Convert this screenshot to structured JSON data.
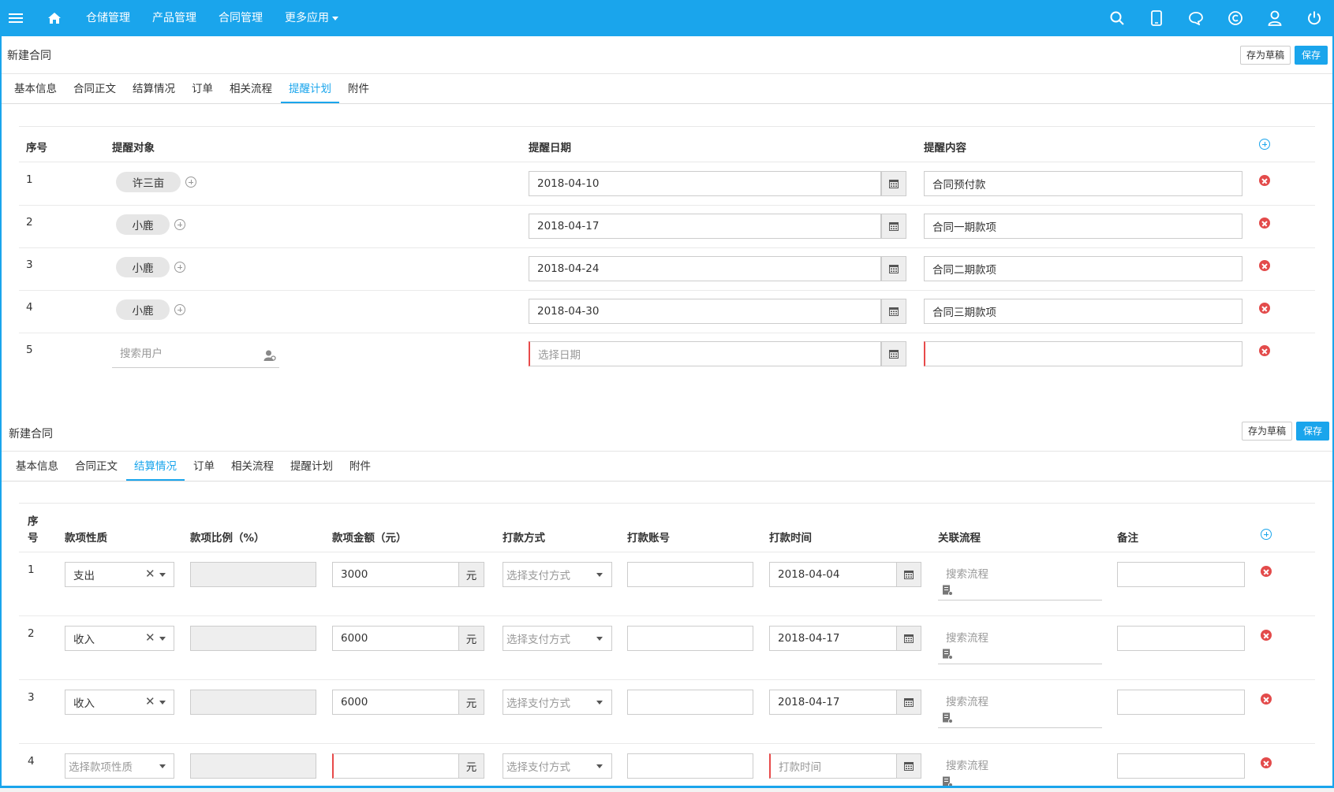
{
  "topbar": {
    "nav": [
      "仓储管理",
      "产品管理",
      "合同管理",
      "更多应用"
    ]
  },
  "panel1": {
    "title": "新建合同",
    "draft_label": "存为草稿",
    "save_label": "保存",
    "tabs": [
      "基本信息",
      "合同正文",
      "结算情况",
      "订单",
      "相关流程",
      "提醒计划",
      "附件"
    ],
    "headers": [
      "序号",
      "提醒对象",
      "提醒日期",
      "提醒内容"
    ],
    "rows": [
      {
        "no": "1",
        "who": "许三亩",
        "date": "2018-04-10",
        "content": "合同预付款"
      },
      {
        "no": "2",
        "who": "小鹿",
        "date": "2018-04-17",
        "content": "合同一期款项"
      },
      {
        "no": "3",
        "who": "小鹿",
        "date": "2018-04-24",
        "content": "合同二期款项"
      },
      {
        "no": "4",
        "who": "小鹿",
        "date": "2018-04-30",
        "content": "合同三期款项"
      },
      {
        "no": "5",
        "who_placeholder": "搜索用户",
        "date_placeholder": "选择日期"
      }
    ]
  },
  "panel2": {
    "title": "新建合同",
    "draft_label": "存为草稿",
    "save_label": "保存",
    "tabs": [
      "基本信息",
      "合同正文",
      "结算情况",
      "订单",
      "相关流程",
      "提醒计划",
      "附件"
    ],
    "headers": {
      "no_line1": "序",
      "no_line2": "号",
      "nature": "款项性质",
      "ratio": "款项比例（%）",
      "amount": "款项金额（元）",
      "pay_method": "打款方式",
      "account": "打款账号",
      "pay_time": "打款时间",
      "flow": "关联流程",
      "remark": "备注"
    },
    "unit": "元",
    "pay_method_placeholder": "选择支付方式",
    "flow_placeholder": "搜索流程",
    "rows": [
      {
        "no": "1",
        "nature": "支出",
        "amount": "3000",
        "time": "2018-04-04"
      },
      {
        "no": "2",
        "nature": "收入",
        "amount": "6000",
        "time": "2018-04-17"
      },
      {
        "no": "3",
        "nature": "收入",
        "amount": "6000",
        "time": "2018-04-17"
      },
      {
        "no": "4",
        "nature_placeholder": "选择款项性质",
        "time_placeholder": "打款时间"
      }
    ]
  }
}
